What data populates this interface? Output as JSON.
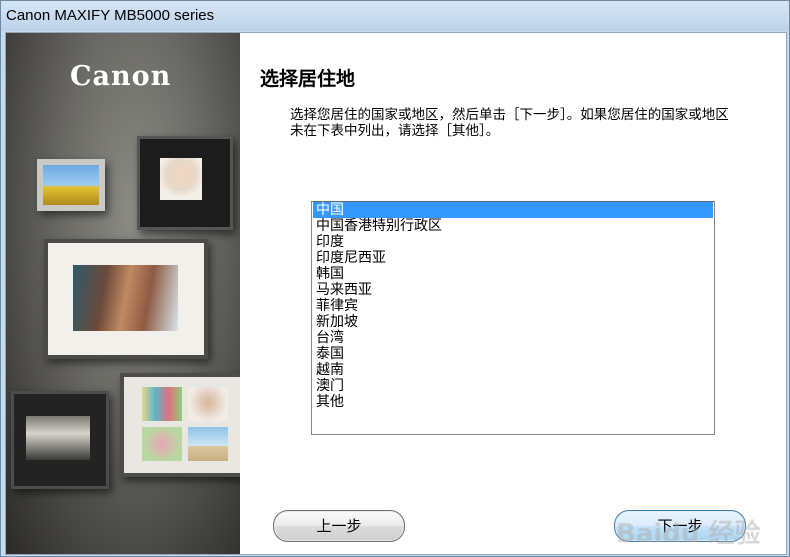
{
  "window": {
    "title": "Canon MAXIFY MB5000 series"
  },
  "sidebar": {
    "logo_text": "Canon"
  },
  "main": {
    "heading": "选择居住地",
    "instruction": "选择您居住的国家或地区，然后单击［下一步］。如果您居住的国家或地区未在下表中列出，请选择［其他］。"
  },
  "region_list": {
    "selected": "中国",
    "items": [
      "中国",
      "中国香港特别行政区",
      "印度",
      "印度尼西亚",
      "韩国",
      "马来西亚",
      "菲律宾",
      "新加坡",
      "台湾",
      "泰国",
      "越南",
      "澳门",
      "其他"
    ]
  },
  "buttons": {
    "back_label": "上一步",
    "next_label": "下一步"
  },
  "watermark": {
    "text": "Baidu 经验"
  },
  "colors": {
    "selection": "#3399ff",
    "titlebar": "#c6dbef"
  }
}
